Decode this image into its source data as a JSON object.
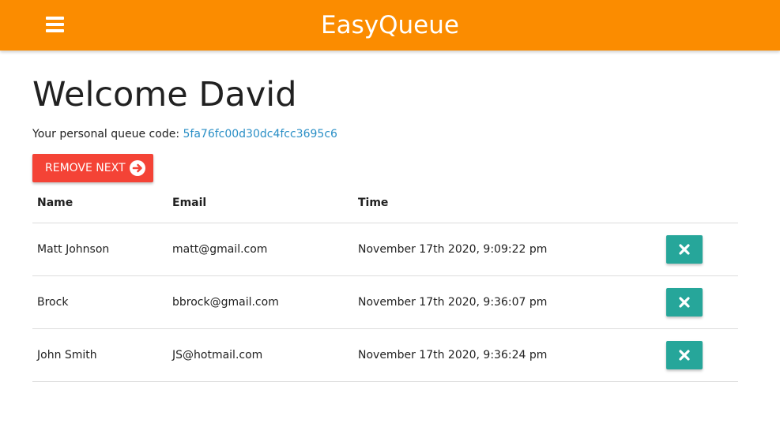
{
  "app": {
    "title": "EasyQueue",
    "brand_color": "#fb8c00"
  },
  "header": {
    "welcome": "Welcome David",
    "queue_code_label": "Your personal queue code:",
    "queue_code": "5fa76fc00d30dc4fcc3695c6"
  },
  "actions": {
    "remove_next_label": "REMOVE NEXT",
    "remove_next_color": "#f44336",
    "delete_color": "#26a69a"
  },
  "table": {
    "columns": [
      "Name",
      "Email",
      "Time"
    ],
    "rows": [
      {
        "name": "Matt Johnson",
        "email": "matt@gmail.com",
        "time": "November 17th 2020, 9:09:22 pm"
      },
      {
        "name": "Brock",
        "email": "bbrock@gmail.com",
        "time": "November 17th 2020, 9:36:07 pm"
      },
      {
        "name": "John Smith",
        "email": "JS@hotmail.com",
        "time": "November 17th 2020, 9:36:24 pm"
      }
    ]
  },
  "icons": {
    "menu": "hamburger-menu-icon",
    "remove_next": "arrow-circle-right-icon",
    "delete": "close-x-icon"
  }
}
